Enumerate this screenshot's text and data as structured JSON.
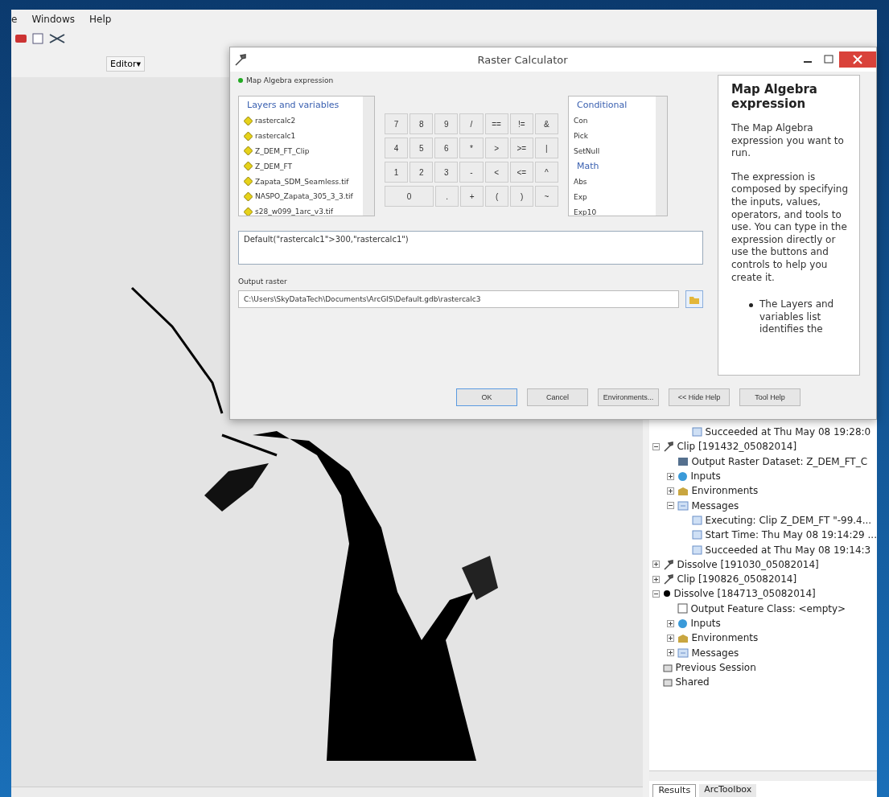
{
  "menu": [
    "e",
    "Windows",
    "Help"
  ],
  "toolbar": {
    "editor": "Editor▾"
  },
  "dialog": {
    "title": "Raster Calculator",
    "section": "Map Algebra expression",
    "layers_header": "Layers and variables",
    "layers": [
      "rastercalc2",
      "rastercalc1",
      "Z_DEM_FT_Clip",
      "Z_DEM_FT",
      "Zapata_SDM_Seamless.tif",
      "NASPO_Zapata_305_3_3.tif",
      "s28_w099_1arc_v3.tif"
    ],
    "keys": [
      [
        "7",
        "8",
        "9",
        "/",
        "==",
        "!=",
        "&"
      ],
      [
        "4",
        "5",
        "6",
        "*",
        ">",
        ">=",
        "|"
      ],
      [
        "1",
        "2",
        "3",
        "-",
        "<",
        "<=",
        "^"
      ],
      [
        "0",
        ".",
        "+",
        "(",
        ")",
        "~"
      ]
    ],
    "functions": [
      {
        "kind": "header",
        "label": "Conditional"
      },
      {
        "kind": "item",
        "label": "Con"
      },
      {
        "kind": "item",
        "label": "Pick"
      },
      {
        "kind": "item",
        "label": "SetNull"
      },
      {
        "kind": "header",
        "label": "Math"
      },
      {
        "kind": "item",
        "label": "Abs"
      },
      {
        "kind": "item",
        "label": "Exp"
      },
      {
        "kind": "item",
        "label": "Exp10"
      }
    ],
    "expression": "Default(\"rastercalc1\">300,\"rastercalc1\")",
    "output_label": "Output raster",
    "output_value": "C:\\Users\\SkyDataTech\\Documents\\ArcGIS\\Default.gdb\\rastercalc3",
    "help": {
      "title": "Map Algebra expression",
      "paragraphs": [
        "The Map Algebra expression you want to run.",
        "The expression is composed by specifying the inputs, values, operators, and tools to use. You can type in the expression directly or use the buttons and controls to help you create it."
      ],
      "bullet": "The Layers and variables list identifies the"
    },
    "buttons": [
      "OK",
      "Cancel",
      "Environments...",
      "<< Hide Help",
      "Tool Help"
    ]
  },
  "results_continued": [
    {
      "kind": "message",
      "label": "Succeeded at Thu May 08 19:28:0"
    }
  ],
  "results_tree": [
    {
      "kind": "tool",
      "label": "Clip [191432_05082014]",
      "expanded": true,
      "children": [
        {
          "kind": "raster",
          "label": "Output Raster Dataset: Z_DEM_FT_C"
        },
        {
          "kind": "inputs",
          "label": "Inputs",
          "expanded": false
        },
        {
          "kind": "environments",
          "label": "Environments",
          "expanded": false
        },
        {
          "kind": "messages",
          "label": "Messages",
          "expanded": true,
          "children": [
            {
              "kind": "message",
              "label": "Executing: Clip Z_DEM_FT \"-99.4..."
            },
            {
              "kind": "message",
              "label": "Start Time: Thu May 08 19:14:29 ..."
            },
            {
              "kind": "message",
              "label": "Succeeded at Thu May 08 19:14:3"
            }
          ]
        }
      ]
    },
    {
      "kind": "tool",
      "label": "Dissolve [191030_05082014]",
      "expanded": false
    },
    {
      "kind": "tool",
      "label": "Clip [190826_05082014]",
      "expanded": false
    },
    {
      "kind": "dot",
      "label": "Dissolve [184713_05082014]",
      "expanded": true,
      "children": [
        {
          "kind": "feature",
          "label": "Output Feature Class: <empty>"
        },
        {
          "kind": "inputs",
          "label": "Inputs",
          "expanded": false
        },
        {
          "kind": "environments",
          "label": "Environments",
          "expanded": false
        },
        {
          "kind": "messages",
          "label": "Messages",
          "expanded": false
        }
      ]
    },
    {
      "kind": "folder",
      "label": "Previous Session"
    },
    {
      "kind": "folder",
      "label": "Shared"
    }
  ],
  "panel_tabs": [
    {
      "label": "Results",
      "selected": true
    },
    {
      "label": "ArcToolbox",
      "selected": false
    }
  ]
}
